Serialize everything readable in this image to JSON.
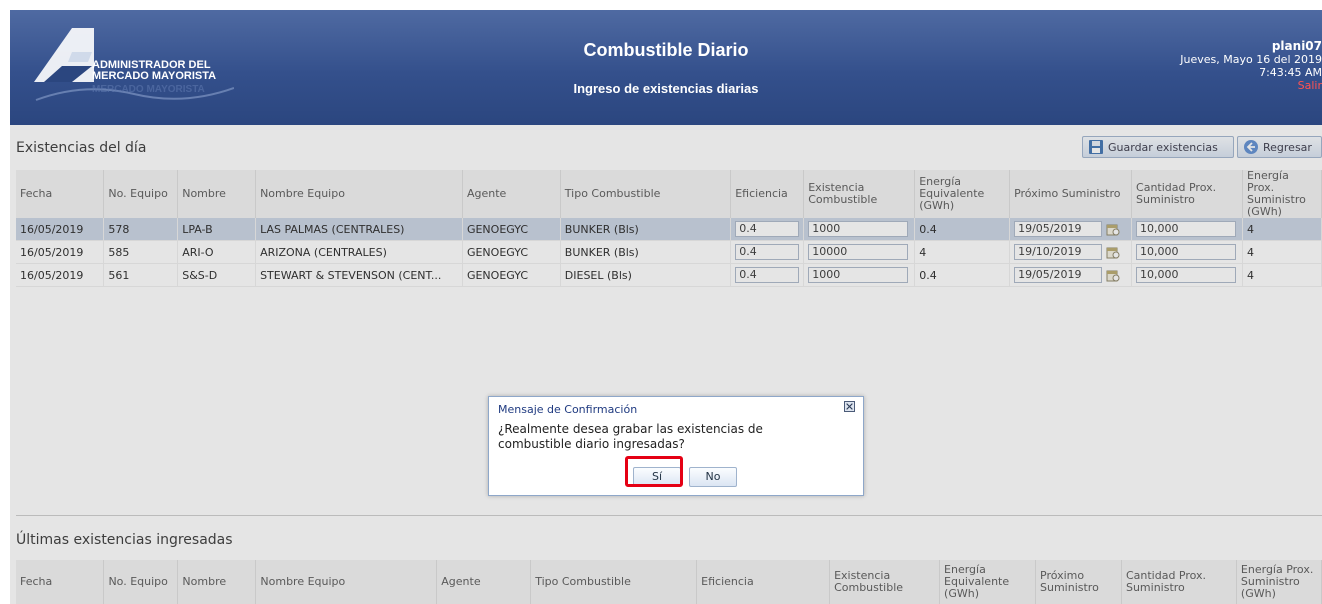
{
  "header": {
    "logo_line1": "ADMINISTRADOR DEL",
    "logo_line2": "MERCADO MAYORISTA",
    "logo_shadow": "MERCADO MAYORISTA",
    "title": "Combustible Diario",
    "subtitle": "Ingreso de existencias diarias",
    "user": "plani07",
    "date": "Jueves, Mayo 16 del 2019",
    "time": "7:43:45 AM",
    "logout": "Salir"
  },
  "toolbar": {
    "save_label": "Guardar existencias",
    "back_label": "Regresar"
  },
  "section1": {
    "title": "Existencias del día",
    "columns": [
      "Fecha",
      "No. Equipo",
      "Nombre",
      "Nombre Equipo",
      "Agente",
      "Tipo Combustible",
      "Eficiencia",
      "Existencia Combustible",
      "Energía Equivalente (GWh)",
      "Próximo Suministro",
      "Cantidad Prox. Suministro",
      "Energía Prox. Suministro (GWh)"
    ],
    "rows": [
      {
        "fecha": "16/05/2019",
        "equipo": "578",
        "nombre": "LPA-B",
        "nombre_equipo": "LAS PALMAS (CENTRALES)",
        "agente": "GENOEGYC",
        "tipo": "BUNKER (Bls)",
        "eficiencia": "0.4",
        "existencia": "1000",
        "energia": "0.4",
        "proximo": "19/05/2019",
        "cantidad": "10,000",
        "energia_prox": "4"
      },
      {
        "fecha": "16/05/2019",
        "equipo": "585",
        "nombre": "ARI-O",
        "nombre_equipo": "ARIZONA (CENTRALES)",
        "agente": "GENOEGYC",
        "tipo": "BUNKER (Bls)",
        "eficiencia": "0.4",
        "existencia": "10000",
        "energia": "4",
        "proximo": "19/10/2019",
        "cantidad": "10,000",
        "energia_prox": "4"
      },
      {
        "fecha": "16/05/2019",
        "equipo": "561",
        "nombre": "S&S-D",
        "nombre_equipo": "STEWART & STEVENSON (CENT...",
        "agente": "GENOEGYC",
        "tipo": "DIESEL (Bls)",
        "eficiencia": "0.4",
        "existencia": "1000",
        "energia": "0.4",
        "proximo": "19/05/2019",
        "cantidad": "10,000",
        "energia_prox": "4"
      }
    ]
  },
  "section2": {
    "title": "Últimas existencias ingresadas",
    "columns": [
      "Fecha",
      "No. Equipo",
      "Nombre",
      "Nombre Equipo",
      "Agente",
      "Tipo Combustible",
      "Eficiencia",
      "Existencia Combustible",
      "Energía Equivalente (GWh)",
      "Próximo Suministro",
      "Cantidad Prox. Suministro",
      "Energía Prox. Suministro (GWh)"
    ]
  },
  "dialog": {
    "title": "Mensaje de Confirmación",
    "message": "¿Realmente desea grabar las existencias de combustible diario ingresadas?",
    "yes_label": "Sí",
    "no_label": "No"
  }
}
